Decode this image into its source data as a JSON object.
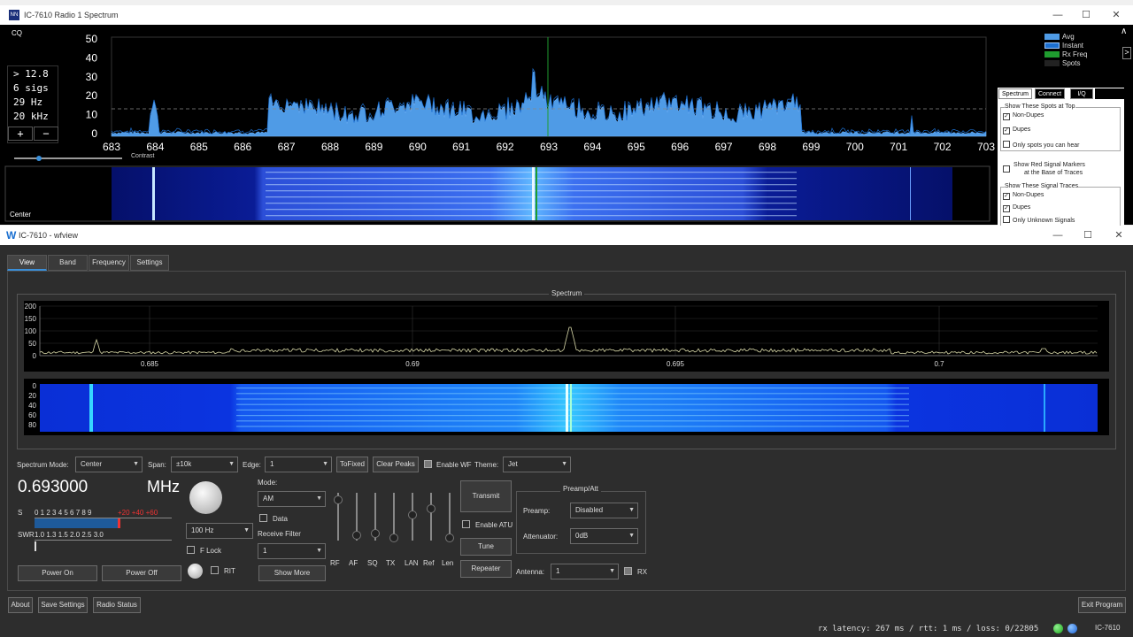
{
  "win1": {
    "title": "IC-7610 Radio 1 Spectrum",
    "icon_text": "NN",
    "cq_label": "CQ",
    "sig_lines": [
      "> 12.8",
      "6 sigs",
      "29 Hz",
      "20 kHz"
    ],
    "plus": "+",
    "minus": "−",
    "y_ticks": [
      "50",
      "40",
      "30",
      "20",
      "10",
      "0"
    ],
    "x_ticks": [
      "683",
      "684",
      "685",
      "686",
      "687",
      "688",
      "689",
      "690",
      "691",
      "692",
      "693",
      "694",
      "695",
      "696",
      "697",
      "698",
      "699",
      "700",
      "701",
      "702",
      "703"
    ],
    "contrast_label": "Contrast",
    "center_label": "Center",
    "legend": [
      "Avg",
      "Instant",
      "Rx Freq",
      "Spots"
    ],
    "tabs": [
      "Spectrum",
      "Connect",
      "I/Q"
    ],
    "group1_title": "Show These Spots at Top",
    "group1_items": [
      "Non-Dupes",
      "Dupes",
      "Only spots you can hear"
    ],
    "red_markers": [
      "Show Red Signal Markers",
      "at the Base of Traces"
    ],
    "group2_title": "Show These Signal Traces",
    "group2_items": [
      "Non-Dupes",
      "Dupes",
      "Only Unknown Signals"
    ],
    "colors": {
      "avg": "#4f9be6",
      "instant": "#1c6fd0",
      "rxfreq": "#1f9c2f",
      "spots": "#222222"
    }
  },
  "win2": {
    "title": "IC-7610 - wfview",
    "icon_text": "W",
    "tabs": [
      "View",
      "Band",
      "Frequency",
      "Settings"
    ],
    "spectrum_title": "Spectrum",
    "spec_y_ticks": [
      "200",
      "150",
      "100",
      "50",
      "0"
    ],
    "spec_x_ticks": [
      "0.685",
      "0.69",
      "0.695",
      "0.7"
    ],
    "wf_y_ticks": [
      "0",
      "20",
      "40",
      "60",
      "80"
    ],
    "controls": {
      "spectrum_mode_label": "Spectrum Mode:",
      "spectrum_mode_value": "Center",
      "span_label": "Span:",
      "span_value": "±10k",
      "edge_label": "Edge:",
      "edge_value": "1",
      "tofixed": "ToFixed",
      "clear_peaks": "Clear Peaks",
      "enable_wf": "Enable WF",
      "theme_label": "Theme:",
      "theme_value": "Jet"
    },
    "frequency": "0.693000",
    "freq_unit": "MHz",
    "s_label": "S",
    "s_scale": "0 1 2 3 4 5 6 7 8 9",
    "s_plus": "+20   +40   +60",
    "swr_label": "SWR",
    "swr_scale": "1.0  1.3  1.5    2.0 2.5 3.0",
    "step_value": "100 Hz",
    "flock_label": "F Lock",
    "rit_label": "RIT",
    "power_on": "Power On",
    "power_off": "Power Off",
    "mode_label": "Mode:",
    "mode_value": "AM",
    "data_label": "Data",
    "receive_filter_label": "Receive Filter",
    "filter_value": "1",
    "show_more": "Show More",
    "slider_labels": [
      "RF",
      "AF",
      "SQ",
      "TX",
      "LAN",
      "Ref",
      "Len"
    ],
    "transmit": "Transmit",
    "enable_atu": "Enable ATU",
    "tune": "Tune",
    "repeater": "Repeater",
    "preamp_group": "Preamp/Att",
    "preamp_label": "Preamp:",
    "preamp_value": "Disabled",
    "attenuator_label": "Attenuator:",
    "attenuator_value": "0dB",
    "antenna_label": "Antenna:",
    "antenna_value": "1",
    "rx_label": "RX",
    "about": "About",
    "save_settings": "Save Settings",
    "radio_status": "Radio Status",
    "exit_program": "Exit Program",
    "status_text": "rx latency: 267 ms / rtt:  1 ms / loss:   0/22805",
    "radio_name": "IC-7610"
  }
}
